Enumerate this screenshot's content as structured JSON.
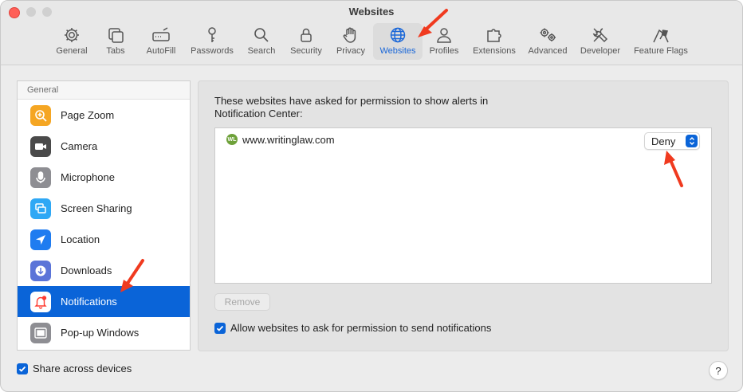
{
  "window": {
    "title": "Websites"
  },
  "toolbar": {
    "items": [
      {
        "label": "General",
        "icon": "gear-icon"
      },
      {
        "label": "Tabs",
        "icon": "tabs-icon"
      },
      {
        "label": "AutoFill",
        "icon": "autofill-icon"
      },
      {
        "label": "Passwords",
        "icon": "key-icon"
      },
      {
        "label": "Search",
        "icon": "search-icon"
      },
      {
        "label": "Security",
        "icon": "lock-icon"
      },
      {
        "label": "Privacy",
        "icon": "hand-icon"
      },
      {
        "label": "Websites",
        "icon": "globe-icon",
        "active": true
      },
      {
        "label": "Profiles",
        "icon": "person-icon"
      },
      {
        "label": "Extensions",
        "icon": "puzzle-icon"
      },
      {
        "label": "Advanced",
        "icon": "gears-icon"
      },
      {
        "label": "Developer",
        "icon": "tools-icon"
      },
      {
        "label": "Feature Flags",
        "icon": "flags-icon"
      }
    ]
  },
  "sidebar": {
    "header": "General",
    "items": [
      {
        "label": "Page Zoom",
        "icon": "zoom-icon",
        "color": "#f5a623"
      },
      {
        "label": "Camera",
        "icon": "camera-icon",
        "color": "#4a4a4a"
      },
      {
        "label": "Microphone",
        "icon": "microphone-icon",
        "color": "#8e8e93"
      },
      {
        "label": "Screen Sharing",
        "icon": "screen-sharing-icon",
        "color": "#2fa8f5"
      },
      {
        "label": "Location",
        "icon": "location-icon",
        "color": "#1f7cf0"
      },
      {
        "label": "Downloads",
        "icon": "downloads-icon",
        "color": "#5b74d8"
      },
      {
        "label": "Notifications",
        "icon": "bell-icon",
        "color": "#ff3b30",
        "selected": true
      },
      {
        "label": "Pop-up Windows",
        "icon": "popup-icon",
        "color": "#8e8e93"
      }
    ]
  },
  "main": {
    "description": "These websites have asked for permission to show alerts in Notification Center:",
    "sites": [
      {
        "favicon_text": "WL",
        "domain": "www.writinglaw.com",
        "setting": "Deny"
      }
    ],
    "remove_label": "Remove",
    "allow_label": "Allow websites to ask for permission to send notifications",
    "allow_checked": true
  },
  "footer": {
    "share_label": "Share across devices",
    "share_checked": true,
    "help_label": "?"
  },
  "colors": {
    "accent": "#0a64d8",
    "annotation_arrow": "#f03a1f"
  }
}
